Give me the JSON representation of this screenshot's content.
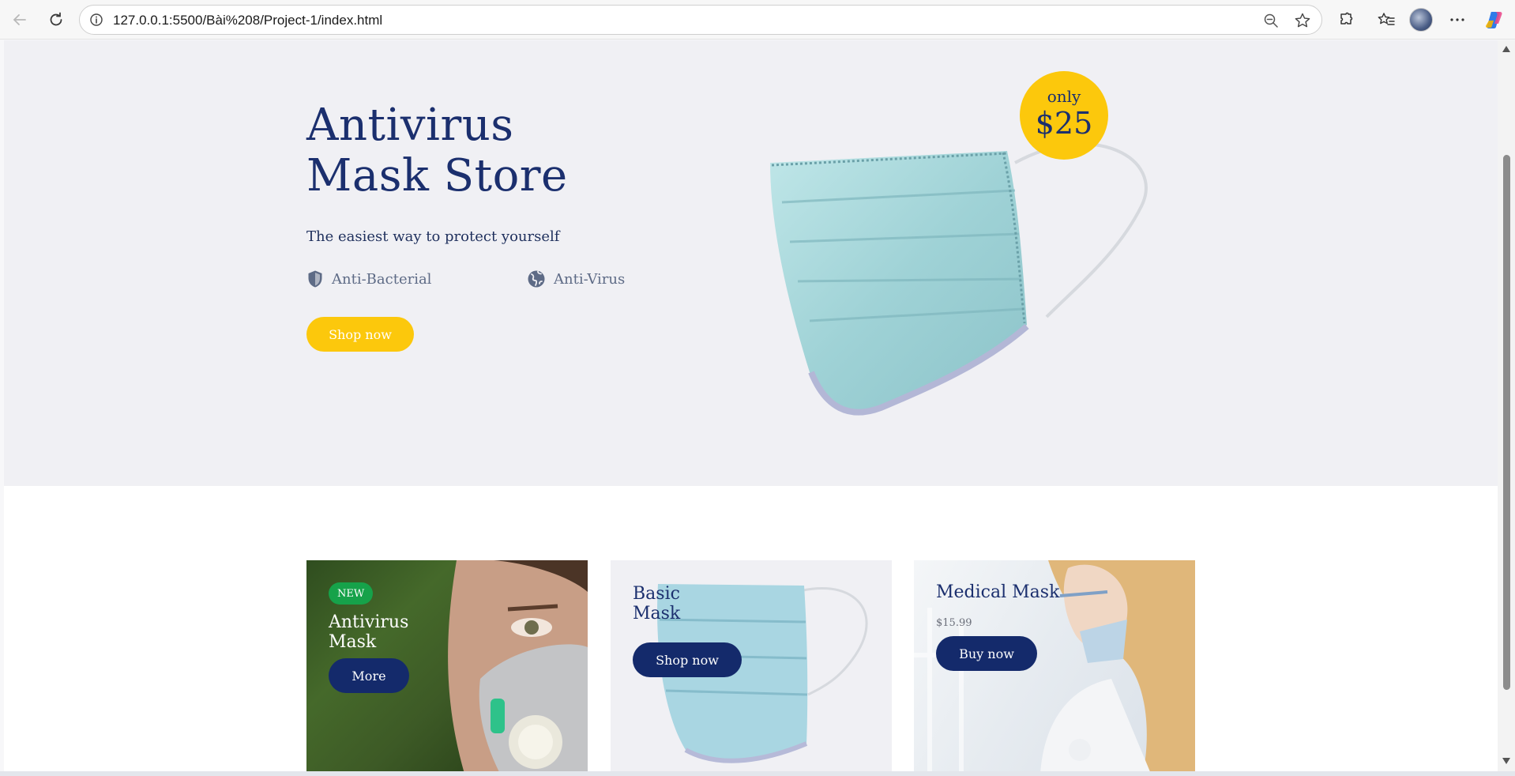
{
  "browser": {
    "url": "127.0.0.1:5500/Bài%208/Project-1/index.html"
  },
  "hero": {
    "title_line1": "Antivirus",
    "title_line2": "Mask Store",
    "subtitle": "The easiest way to protect yourself",
    "feature1": "Anti-Bacterial",
    "feature2": "Anti-Virus",
    "cta": "Shop now",
    "badge_only": "only",
    "badge_price": "$25"
  },
  "cards": [
    {
      "badge": "NEW",
      "title_line1": "Antivirus",
      "title_line2": "Mask",
      "button": "More"
    },
    {
      "title_line1": "Basic",
      "title_line2": "Mask",
      "button": "Shop now"
    },
    {
      "title": "Medical Mask",
      "price": "$15.99",
      "button": "Buy now"
    }
  ],
  "colors": {
    "navy": "#1b2f6e",
    "yellow": "#fcc80c",
    "green_badge": "#16a24a",
    "hero_bg": "#f0f0f4"
  }
}
